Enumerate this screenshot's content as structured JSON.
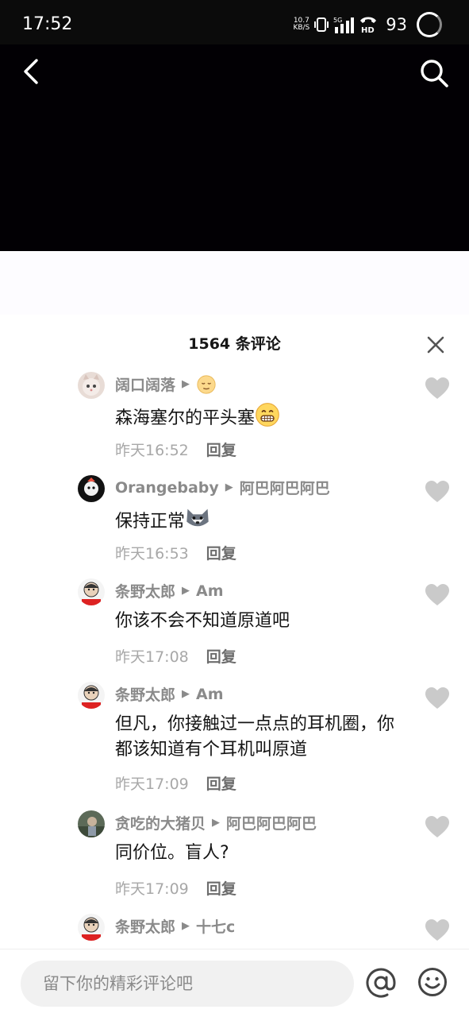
{
  "status_bar": {
    "time": "17:52",
    "net_speed_value": "10.7",
    "net_speed_unit": "KB/S",
    "battery": "93",
    "icons": [
      "vibrate-icon",
      "signal-5g-icon",
      "hd-call-icon",
      "battery-ring-icon"
    ]
  },
  "header": {
    "back_icon": "chevron-left-icon",
    "search_icon": "search-icon"
  },
  "comments_sheet": {
    "title": "1564 条评论",
    "close_icon": "close-icon",
    "reply_label": "回复",
    "comments": [
      {
        "user": "阔口阔落",
        "reply_to": "",
        "reply_to_emoji": "relieved-face-emoji",
        "text": "森海塞尔的平头塞",
        "text_emoji": "grin-emoji",
        "time": "昨天16:52",
        "avatar": "cat-avatar"
      },
      {
        "user": "Orangebaby",
        "reply_to": "阿巴阿巴阿巴",
        "text": "保持正常",
        "text_emoji": "husky-dog-emoji",
        "time": "昨天16:53",
        "avatar": "dark-avatar"
      },
      {
        "user": "条野太郎",
        "reply_to": "Am",
        "text": "你该不会不知道原道吧",
        "time": "昨天17:08",
        "avatar": "cartoon-man-avatar"
      },
      {
        "user": "条野太郎",
        "reply_to": "Am",
        "text": "但凡，你接触过一点点的耳机圈，你都该知道有个耳机叫原道",
        "time": "昨天17:09",
        "avatar": "cartoon-man-avatar"
      },
      {
        "user": "贪吃的大猪贝",
        "reply_to": "阿巴阿巴阿巴",
        "text": "同价位。盲人?",
        "time": "昨天17:09",
        "avatar": "photo-avatar"
      },
      {
        "user": "条野太郎",
        "reply_to": "十七c",
        "text": "",
        "time": "",
        "avatar": "cartoon-man-avatar"
      }
    ]
  },
  "composer": {
    "placeholder": "留下你的精彩评论吧",
    "at_icon": "at-icon",
    "emoji_icon": "smiley-icon"
  },
  "colors": {
    "video_bg": "#020004",
    "username": "#8a8a8a",
    "comment_text": "#151515",
    "meta_text": "#a8a8a8",
    "like_heart": "#c9c9c9"
  }
}
